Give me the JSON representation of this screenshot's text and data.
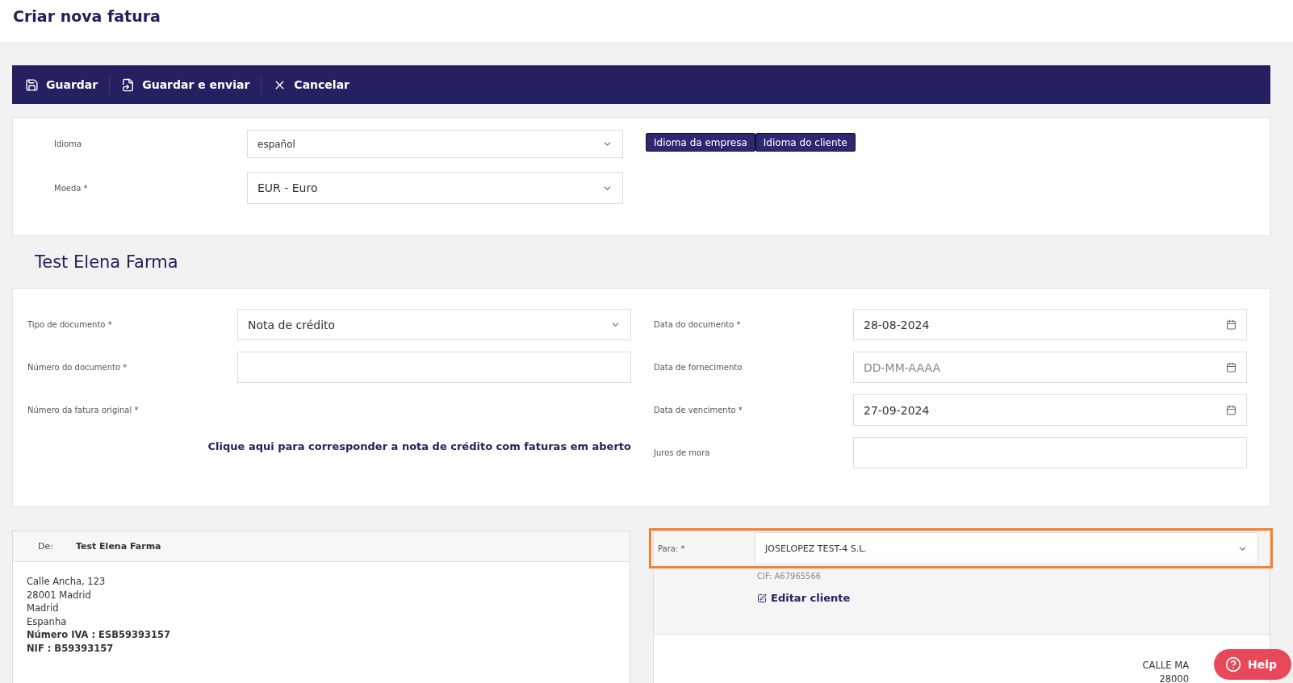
{
  "title": "Criar nova fatura",
  "toolbar": [
    {
      "label": "Guardar",
      "kind": "save"
    },
    {
      "label": "Guardar e enviar",
      "kind": "send"
    },
    {
      "label": "Cancelar",
      "kind": "cancel"
    }
  ],
  "language_panel": {
    "fields": [
      {
        "label": "Idioma",
        "value": "español"
      },
      {
        "label": "Moeda *",
        "value": "EUR - Euro"
      }
    ],
    "buttons": [
      "Idioma da empresa",
      "Idioma do cliente"
    ]
  },
  "company_name": "Test Elena Farma",
  "document_panel": {
    "left_fields": [
      {
        "label": "Tipo de documento *",
        "kind": "select",
        "value": "Nota de crédito"
      },
      {
        "label": "Número do documento *",
        "kind": "input"
      },
      {
        "label": "Número da fatura original *",
        "kind": "label"
      }
    ],
    "link": "Clique aqui para corresponder a nota de crédito com faturas em aberto",
    "right_fields": [
      {
        "label": "Data do documento *",
        "kind": "date",
        "value": "28-08-2024"
      },
      {
        "label": "Data de fornecimento",
        "kind": "date",
        "placeholder": "DD-MM-AAAA"
      },
      {
        "label": "Data de vencimento *",
        "kind": "date",
        "value": "27-09-2024"
      },
      {
        "label": "Juros de mora",
        "kind": "input"
      }
    ]
  },
  "from_card": {
    "label": "De:",
    "name": "Test Elena Farma",
    "address_lines": [
      {
        "text": "Calle Ancha, 123",
        "bold": false
      },
      {
        "text": "28001 Madrid",
        "bold": false
      },
      {
        "text": "Madrid",
        "bold": false
      },
      {
        "text": "Espanha",
        "bold": false
      },
      {
        "text": "Número IVA : ESB59393157",
        "bold": true
      },
      {
        "text": "NIF : B59393157",
        "bold": true
      }
    ]
  },
  "to_card": {
    "label": "Para: *",
    "value": "JOSELOPEZ TEST-4 S.L.",
    "highlighted": true,
    "cif": "CIF: A67965566",
    "edit_link": "Editar cliente",
    "address_lines": [
      "CALLE MA",
      "28000"
    ]
  },
  "help_button": {
    "label": "Help"
  }
}
